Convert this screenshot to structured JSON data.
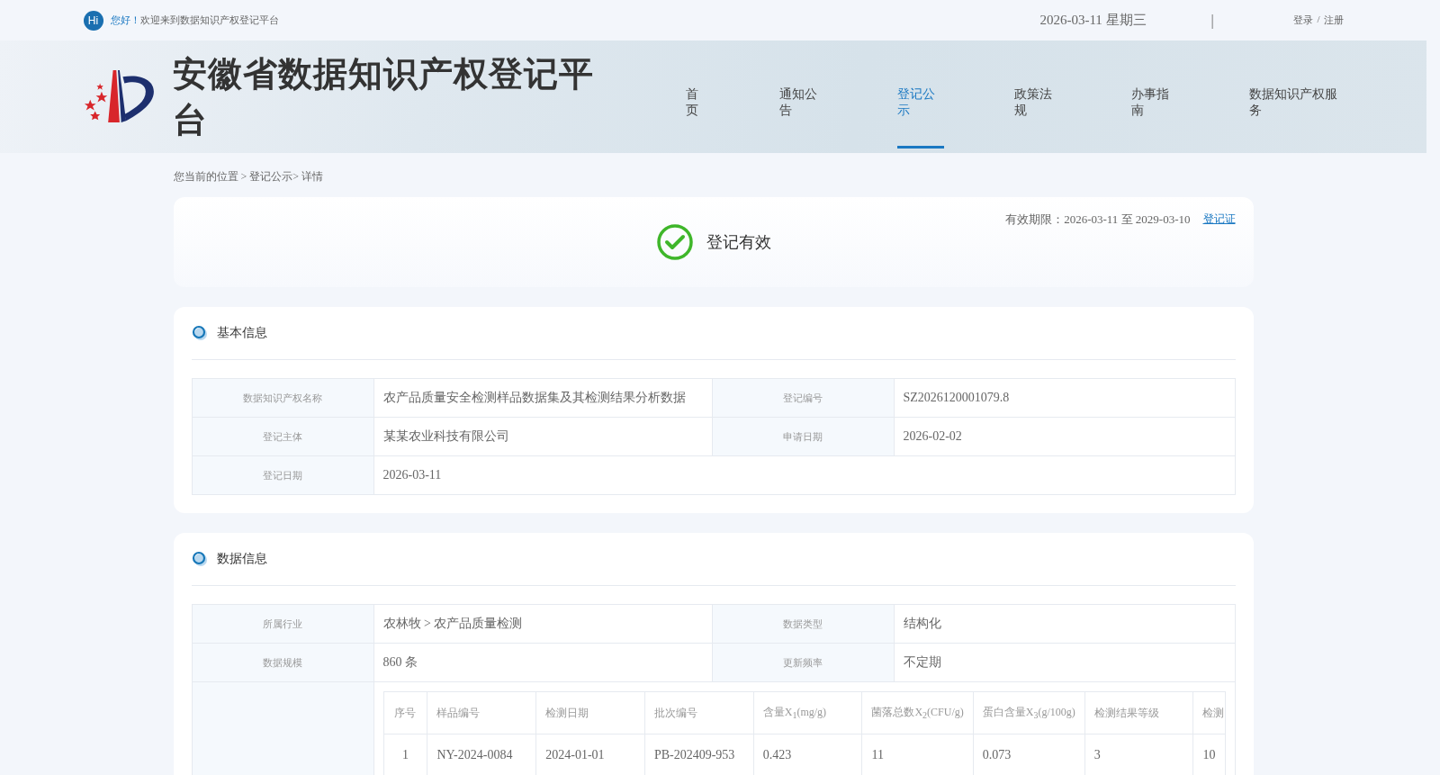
{
  "top_bar": {
    "hi_badge": "Hi",
    "greeting_highlight": "您好！",
    "greeting": "欢迎来到数据知识产权登记平台",
    "date": "2026-03-11 星期三",
    "separator": "|",
    "login": "登录",
    "slash": "/",
    "register": "注册"
  },
  "header": {
    "site_title": "安徽省数据知识产权登记平台",
    "nav": [
      {
        "label": "首页",
        "selected": false
      },
      {
        "label": "通知公告",
        "selected": false
      },
      {
        "label": "登记公示",
        "selected": true
      },
      {
        "label": "政策法规",
        "selected": false
      },
      {
        "label": "办事指南",
        "selected": false
      },
      {
        "label": "数据知识产权服务",
        "selected": false
      }
    ]
  },
  "breadcrumb": "您当前的位置 > 登记公示> 详情",
  "status": {
    "validity": "有效期限：2026-03-11 至 2029-03-10",
    "certificate_link": "登记证",
    "status_text": "登记有效"
  },
  "sections": [
    {
      "title": "基本信息",
      "rows": [
        [
          {
            "label": "数据知识产权名称",
            "value": "农产品质量安全检测样品数据集及其检测结果分析数据"
          },
          {
            "label": "登记编号",
            "value": "SZ2026120001079.8"
          }
        ],
        [
          {
            "label": "登记主体",
            "value": "某某农业科技有限公司"
          },
          {
            "label": "申请日期",
            "value": "2026-02-02"
          }
        ],
        [
          {
            "label": "登记日期",
            "value": "2026-03-11"
          }
        ]
      ]
    },
    {
      "title": "数据信息",
      "rows": [
        [
          {
            "label": "所属行业",
            "value": "农林牧 > 农产品质量检测"
          },
          {
            "label": "数据类型",
            "value": "结构化"
          }
        ],
        [
          {
            "label": "数据规模",
            "value": "860 条"
          },
          {
            "label": "更新频率",
            "value": "不定期"
          }
        ]
      ],
      "sample_table": {
        "columns": [
          "序号",
          "样品编号",
          "检测日期",
          "批次编号",
          "含量X$_{1}$(mg/g)",
          "菌落总数X$_{2}$(CFU/g)",
          "蛋白含量X$_{3}$(g/100g)",
          "检测结果等级",
          "检测"
        ],
        "rows": [
          [
            "1",
            "NY-2024-0084",
            "2024-01-01",
            "PB-202409-953",
            "0.423",
            "11",
            "0.073",
            "3",
            "10"
          ]
        ]
      }
    }
  ]
}
